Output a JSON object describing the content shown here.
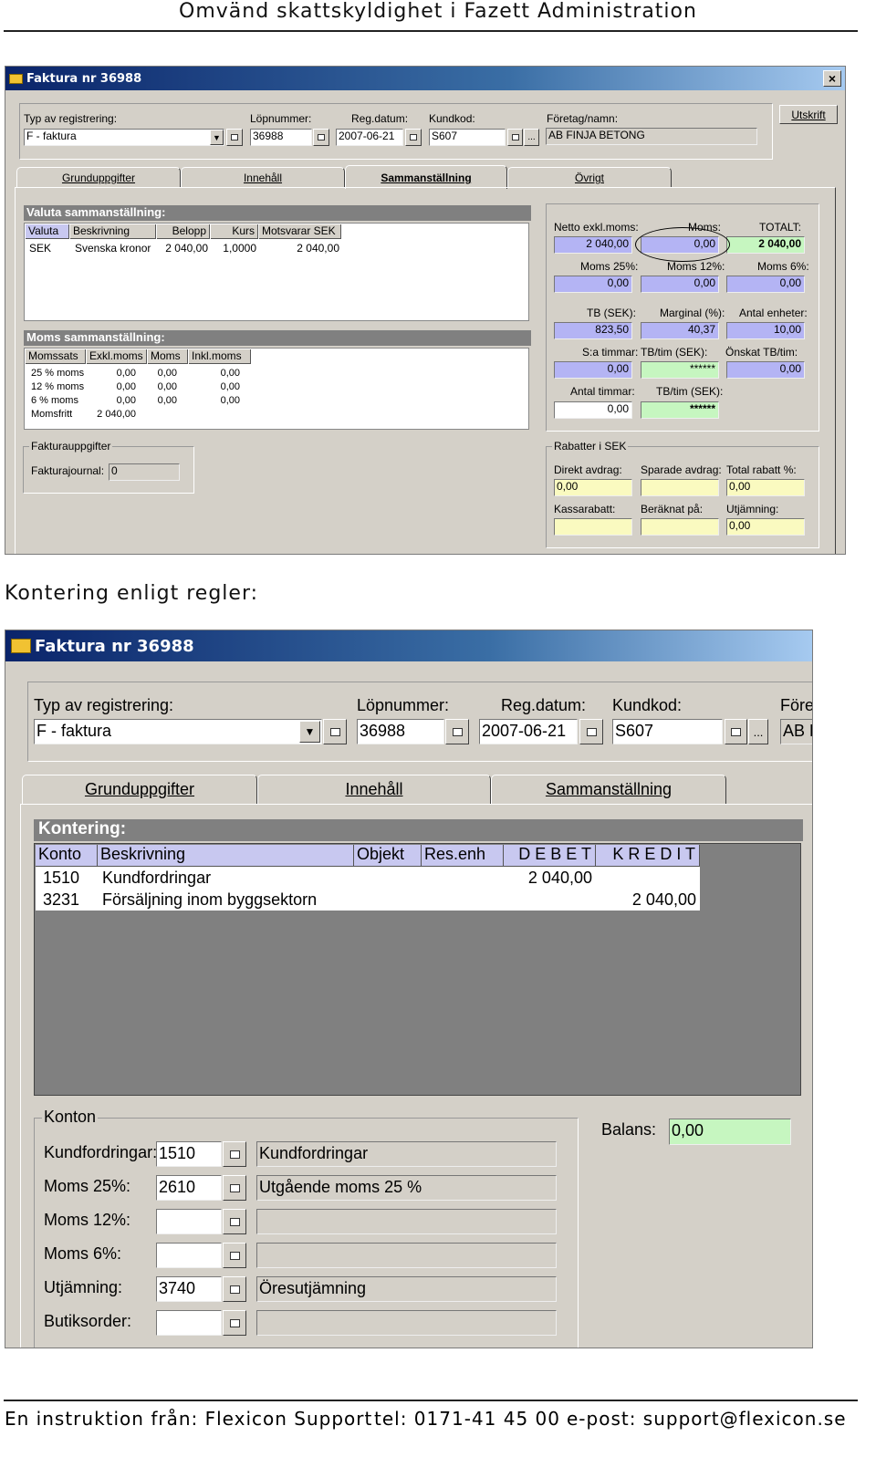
{
  "doc": {
    "title": "Omvänd skattskyldighet i Fazett Administration",
    "section_label": "Kontering enligt regler:",
    "footer": {
      "from": "En instruktion från: Flexicon Support",
      "tel": "tel: 0171-41 45 00",
      "email": "e-post: support@flexicon.se"
    }
  },
  "win1": {
    "title": "Faktura nr 36988",
    "close": "×",
    "print_label": "Utskrift",
    "header": {
      "type_label": "Typ av registrering:",
      "type_value": "F - faktura",
      "lop_label": "Löpnummer:",
      "lop_value": "36988",
      "reg_label": "Reg.datum:",
      "reg_value": "2007-06-21",
      "kund_label": "Kundkod:",
      "kund_value": "S607",
      "ftg_label": "Företag/namn:",
      "ftg_value": "AB FINJA BETONG",
      "ellipsis": "..."
    },
    "tabs": [
      "Grunduppgifter",
      "Innehåll",
      "Sammanställning",
      "Övrigt"
    ],
    "valuta": {
      "title": "Valuta sammanställning:",
      "headers": [
        "Valuta",
        "Beskrivning",
        "Belopp",
        "Kurs",
        "Motsvarar SEK"
      ],
      "row": [
        "SEK",
        "Svenska kronor",
        "2 040,00",
        "1,0000",
        "2 040,00"
      ]
    },
    "moms": {
      "title": "Moms sammanställning:",
      "headers": [
        "Momssats",
        "Exkl.moms",
        "Moms",
        "Inkl.moms"
      ],
      "rows": [
        [
          "25 % moms",
          "0,00",
          "0,00",
          "0,00"
        ],
        [
          "12 % moms",
          "0,00",
          "0,00",
          "0,00"
        ],
        [
          "6 % moms",
          "0,00",
          "0,00",
          "0,00"
        ],
        [
          "Momsfritt",
          "2 040,00",
          "",
          ""
        ]
      ]
    },
    "totals": {
      "netto_label": "Netto exkl.moms:",
      "netto": "2 040,00",
      "moms_label": "Moms:",
      "moms": "0,00",
      "totalt_label": "TOTALT:",
      "totalt": "2 040,00",
      "m25_label": "Moms 25%:",
      "m25": "0,00",
      "m12_label": "Moms 12%:",
      "m12": "0,00",
      "m6_label": "Moms 6%:",
      "m6": "0,00",
      "tb_label": "TB (SEK):",
      "tb": "823,50",
      "marg_label": "Marginal (%):",
      "marg": "40,37",
      "antal_label": "Antal enheter:",
      "antal": "10,00",
      "sat_label": "S:a timmar:",
      "sat": "0,00",
      "tbt_label": "TB/tim (SEK):",
      "tbt": "******",
      "onsk_label": "Önskat TB/tim:",
      "onsk": "0,00",
      "anttim_label": "Antal timmar:",
      "anttim": "0,00",
      "tbt2_label": "TB/tim (SEK):",
      "tbt2": "******"
    },
    "fakt": {
      "legend": "Fakturauppgifter",
      "journal_label": "Fakturajournal:",
      "journal": "0"
    },
    "rabatt": {
      "legend": "Rabatter i SEK",
      "direkt_label": "Direkt avdrag:",
      "direkt": "0,00",
      "sparade_label": "Sparade avdrag:",
      "sparade": "",
      "total_label": "Total rabatt %:",
      "total": "0,00",
      "kassa_label": "Kassarabatt:",
      "kassa": "",
      "berak_label": "Beräknat på:",
      "berak": "",
      "utj_label": "Utjämning:",
      "utj": "0,00"
    }
  },
  "win2": {
    "title": "Faktura nr 36988",
    "header": {
      "type_label": "Typ av registrering:",
      "type_value": "F - faktura",
      "lop_label": "Löpnummer:",
      "lop_value": "36988",
      "reg_label": "Reg.datum:",
      "reg_value": "2007-06-21",
      "kund_label": "Kundkod:",
      "kund_value": "S607",
      "ftg_label": "Föret",
      "ftg_value": "AB F",
      "ellipsis": "..."
    },
    "tabs": [
      "Grunduppgifter",
      "Innehåll",
      "Sammanställning"
    ],
    "kontering": {
      "title": "Kontering:",
      "headers": [
        "Konto",
        "Beskrivning",
        "Objekt",
        "Res.enh",
        "D E B E T",
        "K R E D I T"
      ],
      "rows": [
        [
          "1510",
          "Kundfordringar",
          "",
          "",
          "2 040,00",
          ""
        ],
        [
          "3231",
          "Försäljning inom byggsektorn",
          "",
          "",
          "",
          "2 040,00"
        ]
      ]
    },
    "konton": {
      "legend": "Konton",
      "rows": [
        {
          "label": "Kundfordringar:",
          "value": "1510",
          "desc": "Kundfordringar"
        },
        {
          "label": "Moms 25%:",
          "value": "2610",
          "desc": "Utgående moms 25 %"
        },
        {
          "label": "Moms 12%:",
          "value": "",
          "desc": ""
        },
        {
          "label": "Moms 6%:",
          "value": "",
          "desc": ""
        },
        {
          "label": "Utjämning:",
          "value": "3740",
          "desc": "Öresutjämning"
        },
        {
          "label": "Butiksorder:",
          "value": "",
          "desc": ""
        }
      ]
    },
    "balans_label": "Balans:",
    "balans": "0,00"
  }
}
